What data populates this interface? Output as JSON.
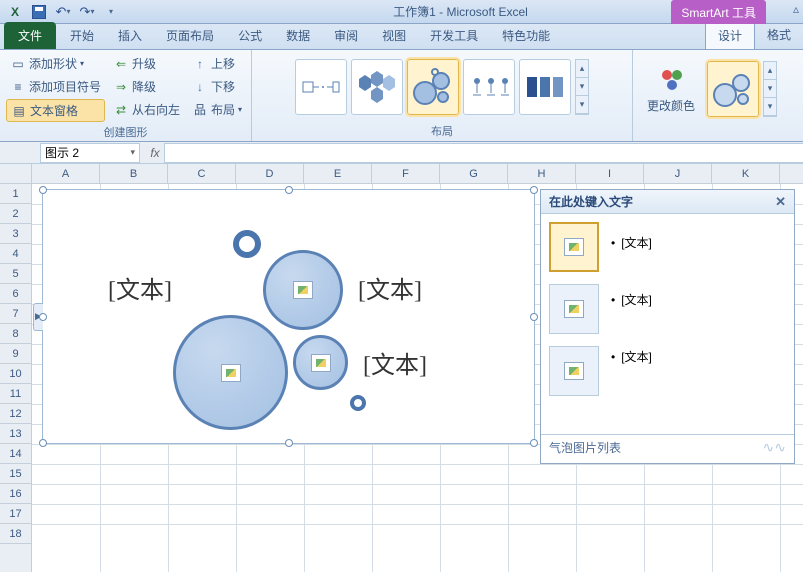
{
  "titlebar": {
    "title": "工作簿1 - Microsoft Excel",
    "context_tool": "SmartArt 工具"
  },
  "tabs": {
    "file": "文件",
    "list": [
      "开始",
      "插入",
      "页面布局",
      "公式",
      "数据",
      "审阅",
      "视图",
      "开发工具",
      "特色功能"
    ],
    "context": [
      "设计",
      "格式"
    ]
  },
  "ribbon": {
    "group1": {
      "label": "创建图形",
      "add_shape": "添加形状",
      "add_bullet": "添加项目符号",
      "text_pane": "文本窗格",
      "promote": "升级",
      "demote": "降级",
      "rtl": "从右向左",
      "move_up": "上移",
      "move_down": "下移",
      "layout": "布局"
    },
    "group2": {
      "label": "布局"
    },
    "group3": {
      "change_colors": "更改颜色"
    }
  },
  "namebox": "图示 2",
  "fx": "fx",
  "columns": [
    "A",
    "B",
    "C",
    "D",
    "E",
    "F",
    "G",
    "H",
    "I",
    "J",
    "K"
  ],
  "rows": [
    "1",
    "2",
    "3",
    "4",
    "5",
    "6",
    "7",
    "8",
    "9",
    "10",
    "11",
    "12",
    "13",
    "14",
    "15",
    "16",
    "17",
    "18"
  ],
  "smartart": {
    "text1": "[文本]",
    "text2": "[文本]",
    "text3": "[文本]"
  },
  "textpane": {
    "title": "在此处键入文字",
    "items": [
      "[文本]",
      "[文本]",
      "[文本]"
    ],
    "footer": "气泡图片列表"
  },
  "chart_data": null
}
